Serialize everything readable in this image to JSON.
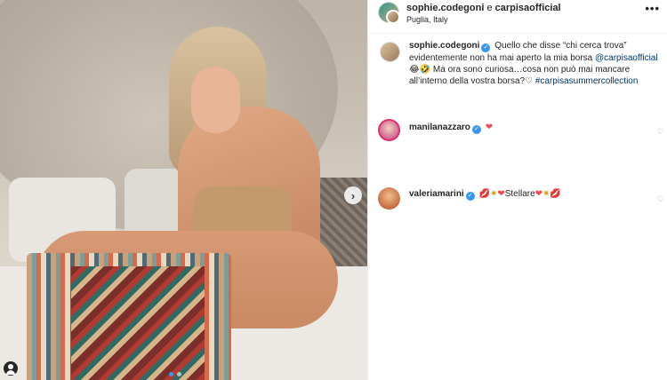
{
  "post": {
    "author": "sophie.codegoni",
    "connector": " e ",
    "coauthor": "carpisaofficial",
    "location": "Puglia, Italy",
    "more_icon": "more-horizontal-icon"
  },
  "caption": {
    "username": "sophie.codegoni",
    "text_part1": "Quello che disse “chi cerca trova” evidentemente non ha mai aperto la mia borsa ",
    "mention": "@carpisaofficial",
    "emojis1": "😂🤣",
    "text_part2": " Ma ora sono curiosa…cosa non può mai mancare all’interno della vostra borsa?",
    "heart_outline": "♡",
    "hashtag": "#carpisasummercollection"
  },
  "comments": [
    {
      "username": "manilanazzaro",
      "text": "",
      "emoji_heart": "❤"
    },
    {
      "username": "valeriamarini",
      "lips1": "💋",
      "sparkle1": "✷",
      "heart1": "❤",
      "text": "Stellare",
      "heart2": "❤",
      "sparkle2": "✷",
      "lips2": "💋"
    }
  ],
  "icons": {
    "verified": "✓",
    "like": "♡",
    "next": "›"
  },
  "colors": {
    "link": "#00376b",
    "verified": "#3897f0",
    "heart": "#ed4956"
  }
}
